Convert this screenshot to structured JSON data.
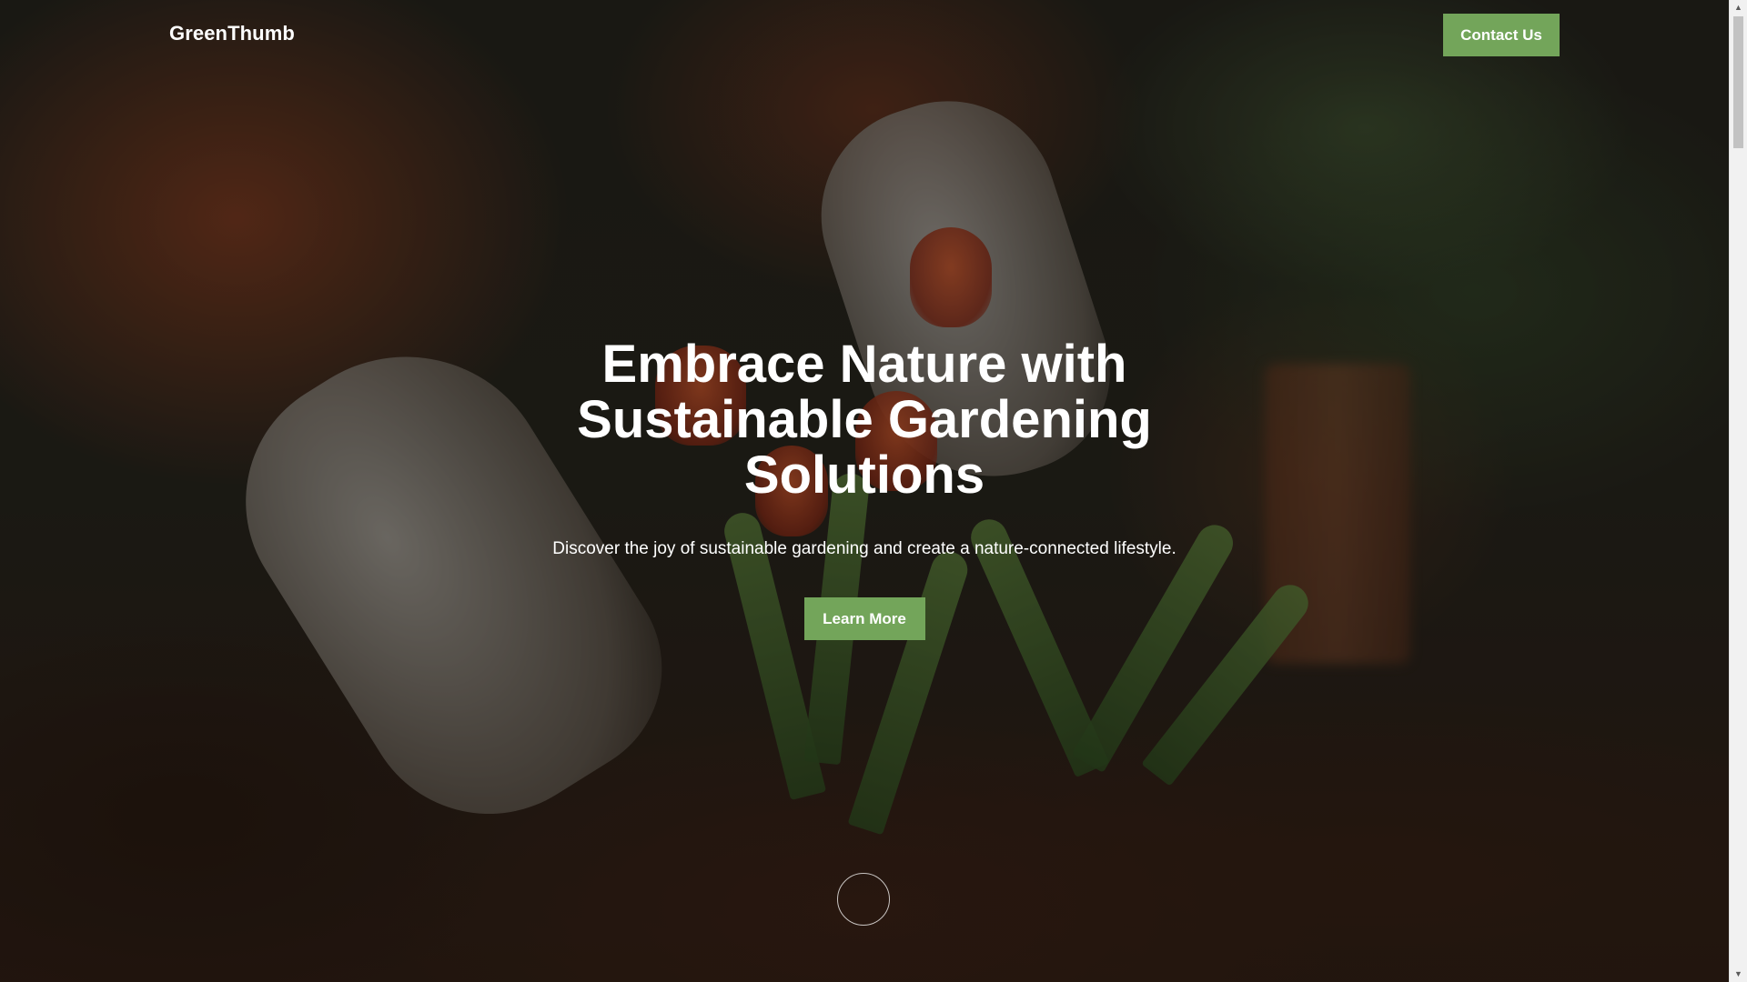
{
  "header": {
    "brand": "GreenThumb",
    "contact_label": "Contact Us"
  },
  "hero": {
    "title": "Embrace Nature with Sustainable Gardening Solutions",
    "subtitle": "Discover the joy of sustainable gardening and create a nature-connected lifestyle.",
    "cta_label": "Learn More",
    "background": "gardener-planting-tulips-photo"
  },
  "colors": {
    "accent": "#73a55a",
    "text": "#ffffff"
  },
  "icons": {
    "scroll_indicator": "circle-outline",
    "scroll_up": "▲",
    "scroll_down": "▼"
  }
}
